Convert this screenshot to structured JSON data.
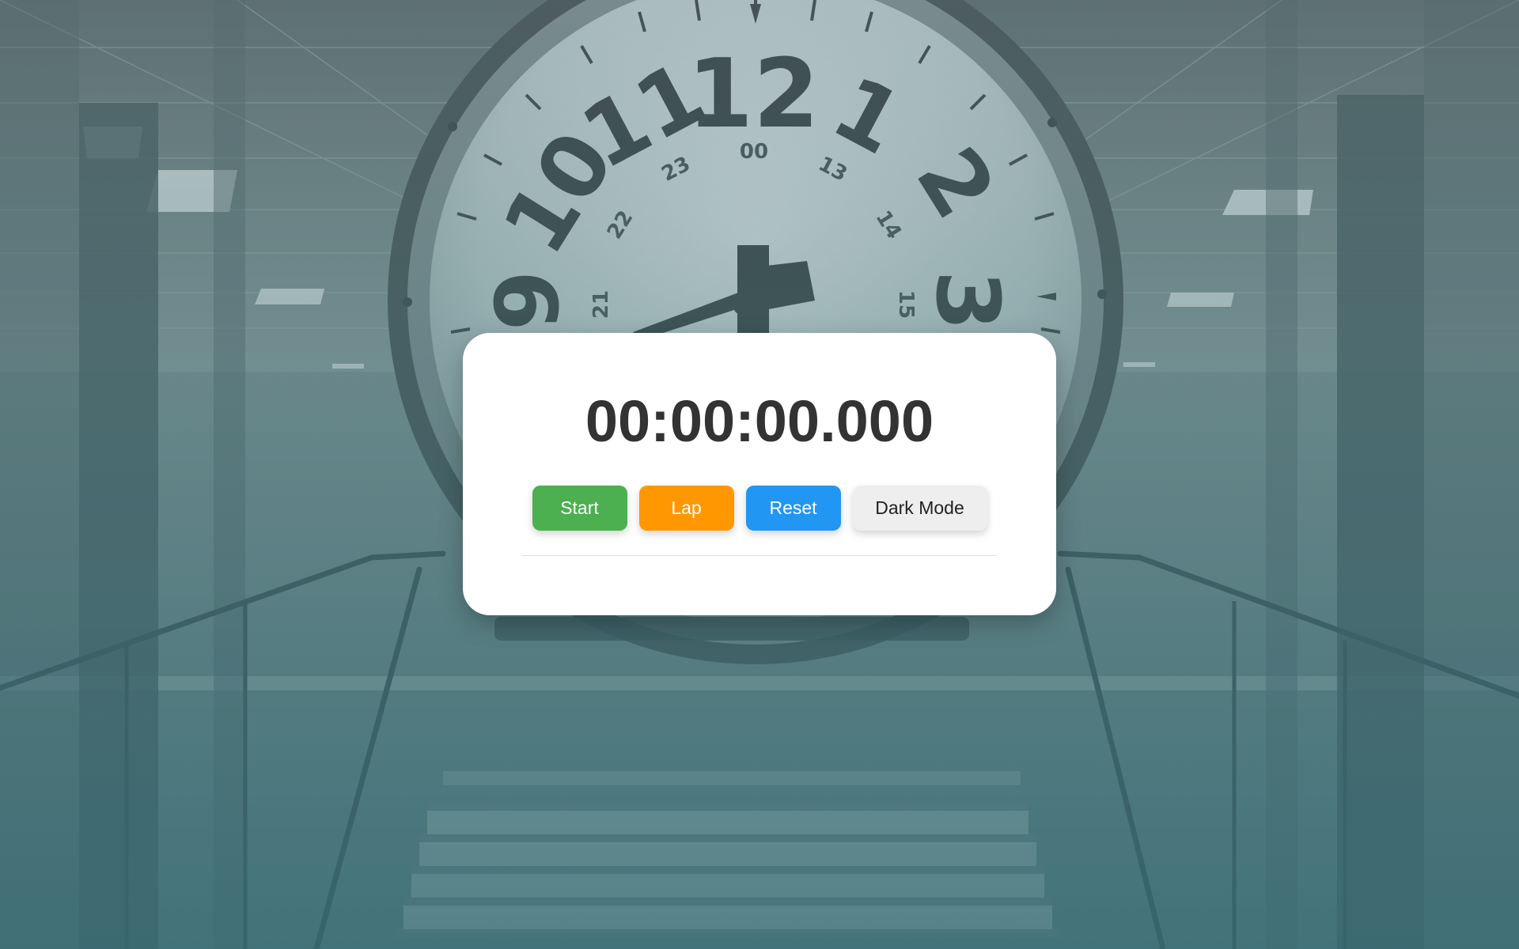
{
  "stopwatch": {
    "time_display": "00:00:00.000",
    "buttons": {
      "start_label": "Start",
      "lap_label": "Lap",
      "reset_label": "Reset",
      "dark_mode_label": "Dark Mode"
    },
    "laps": []
  },
  "background": {
    "clock_hour_numbers": [
      "12",
      "1",
      "2",
      "3",
      "9",
      "10",
      "11"
    ],
    "clock_24h_numbers": [
      "00",
      "13",
      "14",
      "15",
      "21",
      "22",
      "23"
    ]
  },
  "colors": {
    "start": "#4caf50",
    "lap": "#ff9800",
    "reset": "#2196f3",
    "dark_mode": "#eeeeee",
    "timer_text": "#333333"
  }
}
